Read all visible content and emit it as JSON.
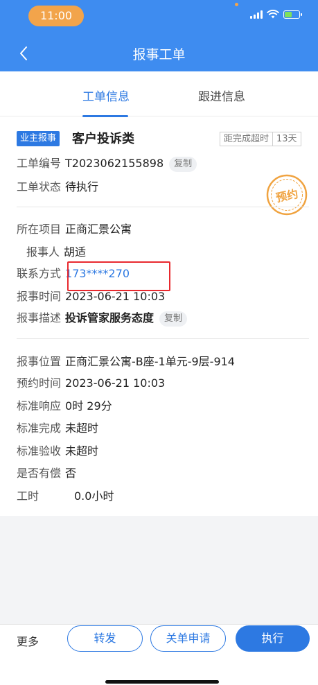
{
  "status_bar": {
    "time": "11:00"
  },
  "nav": {
    "title": "报事工单"
  },
  "tabs": [
    {
      "label": "工单信息",
      "active": true
    },
    {
      "label": "跟进信息",
      "active": false
    }
  ],
  "order": {
    "source_badge": "业主报事",
    "category": "客户投诉类",
    "deadline_label": "距完成超时",
    "deadline_days": "13天",
    "number_label": "工单编号",
    "number": "T2023062155898",
    "copy_label": "复制",
    "status_label": "工单状态",
    "status": "待执行",
    "stamp_text": "预约"
  },
  "project": {
    "project_label": "所在项目",
    "project": "正商汇景公寓",
    "reporter_label": "报事人",
    "reporter": "胡适",
    "contact_label": "联系方式",
    "contact": "173****270",
    "time_label": "报事时间",
    "time": "2023-06-21 10:03",
    "desc_label": "报事描述",
    "desc": "投诉管家服务态度",
    "copy_label": "复制"
  },
  "details": {
    "location_label": "报事位置",
    "location": "正商汇景公寓-B座-1单元-9层-914",
    "appointment_label": "预约时间",
    "appointment": "2023-06-21 10:03",
    "response_label": "标准响应",
    "response": "0时 29分",
    "completion_label": "标准完成",
    "completion": "未超时",
    "acceptance_label": "标准验收",
    "acceptance": "未超时",
    "paid_label": "是否有偿",
    "paid": "否",
    "hours_label": "工时",
    "hours": "0.0小时"
  },
  "actions": {
    "more": "更多",
    "forward": "转发",
    "close_request": "关单申请",
    "execute": "执行"
  },
  "colors": {
    "header": "#3e8cf0",
    "accent": "#2d79e2",
    "time_pill": "#f2a44b",
    "highlight_box": "#e8292e"
  }
}
